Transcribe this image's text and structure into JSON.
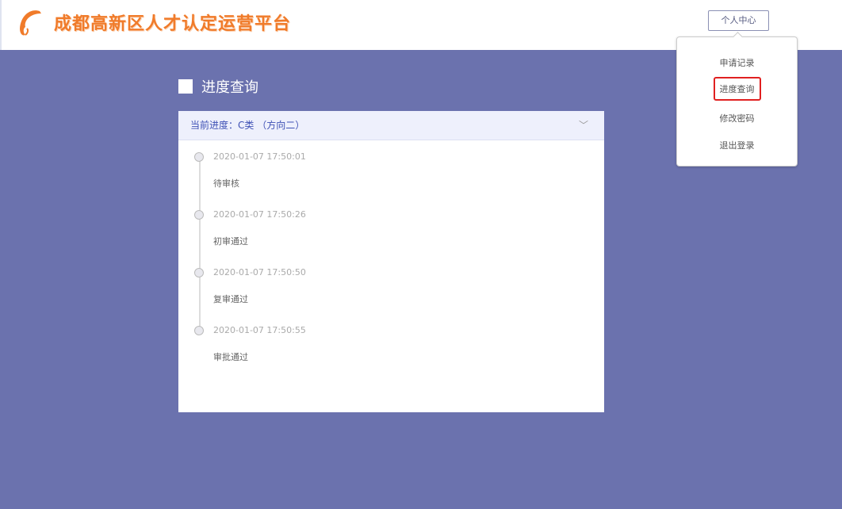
{
  "header": {
    "title": "成都高新区人才认定运营平台",
    "user_center": "个人中心"
  },
  "menu": [
    "申请记录",
    "进度查询",
    "修改密码",
    "退出登录"
  ],
  "page": {
    "title": "进度查询"
  },
  "progress": {
    "current": "当前进度：C类 （方向二）",
    "items": [
      {
        "time": "2020-01-07 17:50:01",
        "status": "待审核"
      },
      {
        "time": "2020-01-07 17:50:26",
        "status": "初审通过"
      },
      {
        "time": "2020-01-07 17:50:50",
        "status": "复审通过"
      },
      {
        "time": "2020-01-07 17:50:55",
        "status": "审批通过"
      }
    ]
  },
  "colors": {
    "accent": "#f07b2a",
    "background": "#6b72ae",
    "highlight": "#e02020"
  }
}
